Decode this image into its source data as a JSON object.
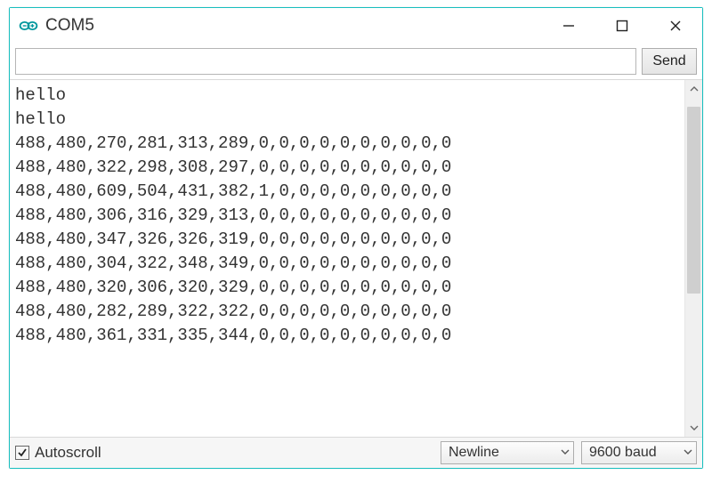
{
  "window": {
    "title": "COM5"
  },
  "input": {
    "value": "",
    "placeholder": ""
  },
  "buttons": {
    "send": "Send"
  },
  "output_lines": [
    "hello",
    "hello",
    "488,480,270,281,313,289,0,0,0,0,0,0,0,0,0,0",
    "488,480,322,298,308,297,0,0,0,0,0,0,0,0,0,0",
    "488,480,609,504,431,382,1,0,0,0,0,0,0,0,0,0",
    "488,480,306,316,329,313,0,0,0,0,0,0,0,0,0,0",
    "488,480,347,326,326,319,0,0,0,0,0,0,0,0,0,0",
    "488,480,304,322,348,349,0,0,0,0,0,0,0,0,0,0",
    "488,480,320,306,320,329,0,0,0,0,0,0,0,0,0,0",
    "488,480,282,289,322,322,0,0,0,0,0,0,0,0,0,0",
    "488,480,361,331,335,344,0,0,0,0,0,0,0,0,0,0"
  ],
  "bottom": {
    "autoscroll_label": "Autoscroll",
    "autoscroll_checked": true,
    "line_ending": "Newline",
    "baud": "9600 baud"
  }
}
